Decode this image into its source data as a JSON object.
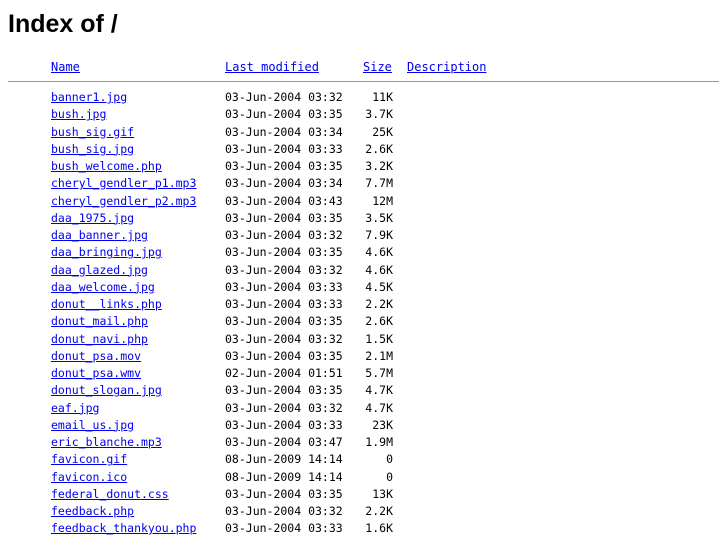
{
  "page": {
    "title": "Index of /"
  },
  "columns": {
    "name": "Name",
    "modified": "Last modified",
    "size": "Size",
    "description": "Description"
  },
  "files": [
    {
      "name": "banner1.jpg",
      "modified": "03-Jun-2004 03:32",
      "size": "11K"
    },
    {
      "name": "bush.jpg",
      "modified": "03-Jun-2004 03:35",
      "size": "3.7K"
    },
    {
      "name": "bush_sig.gif",
      "modified": "03-Jun-2004 03:34",
      "size": "25K"
    },
    {
      "name": "bush_sig.jpg",
      "modified": "03-Jun-2004 03:33",
      "size": "2.6K"
    },
    {
      "name": "bush_welcome.php",
      "modified": "03-Jun-2004 03:35",
      "size": "3.2K"
    },
    {
      "name": "cheryl_gendler_p1.mp3",
      "modified": "03-Jun-2004 03:34",
      "size": "7.7M"
    },
    {
      "name": "cheryl_gendler_p2.mp3",
      "modified": "03-Jun-2004 03:43",
      "size": "12M"
    },
    {
      "name": "daa_1975.jpg",
      "modified": "03-Jun-2004 03:35",
      "size": "3.5K"
    },
    {
      "name": "daa_banner.jpg",
      "modified": "03-Jun-2004 03:32",
      "size": "7.9K"
    },
    {
      "name": "daa_bringing.jpg",
      "modified": "03-Jun-2004 03:35",
      "size": "4.6K"
    },
    {
      "name": "daa_glazed.jpg",
      "modified": "03-Jun-2004 03:32",
      "size": "4.6K"
    },
    {
      "name": "daa_welcome.jpg",
      "modified": "03-Jun-2004 03:33",
      "size": "4.5K"
    },
    {
      "name": "donut__links.php",
      "modified": "03-Jun-2004 03:33",
      "size": "2.2K"
    },
    {
      "name": "donut_mail.php",
      "modified": "03-Jun-2004 03:35",
      "size": "2.6K"
    },
    {
      "name": "donut_navi.php",
      "modified": "03-Jun-2004 03:32",
      "size": "1.5K"
    },
    {
      "name": "donut_psa.mov",
      "modified": "03-Jun-2004 03:35",
      "size": "2.1M"
    },
    {
      "name": "donut_psa.wmv",
      "modified": "02-Jun-2004 01:51",
      "size": "5.7M"
    },
    {
      "name": "donut_slogan.jpg",
      "modified": "03-Jun-2004 03:35",
      "size": "4.7K"
    },
    {
      "name": "eaf.jpg",
      "modified": "03-Jun-2004 03:32",
      "size": "4.7K"
    },
    {
      "name": "email_us.jpg",
      "modified": "03-Jun-2004 03:33",
      "size": "23K"
    },
    {
      "name": "eric_blanche.mp3",
      "modified": "03-Jun-2004 03:47",
      "size": "1.9M"
    },
    {
      "name": "favicon.gif",
      "modified": "08-Jun-2009 14:14",
      "size": "0"
    },
    {
      "name": "favicon.ico",
      "modified": "08-Jun-2009 14:14",
      "size": "0"
    },
    {
      "name": "federal_donut.css",
      "modified": "03-Jun-2004 03:35",
      "size": "13K"
    },
    {
      "name": "feedback.php",
      "modified": "03-Jun-2004 03:32",
      "size": "2.2K"
    },
    {
      "name": "feedback_thankyou.php",
      "modified": "03-Jun-2004 03:33",
      "size": "1.6K"
    }
  ]
}
